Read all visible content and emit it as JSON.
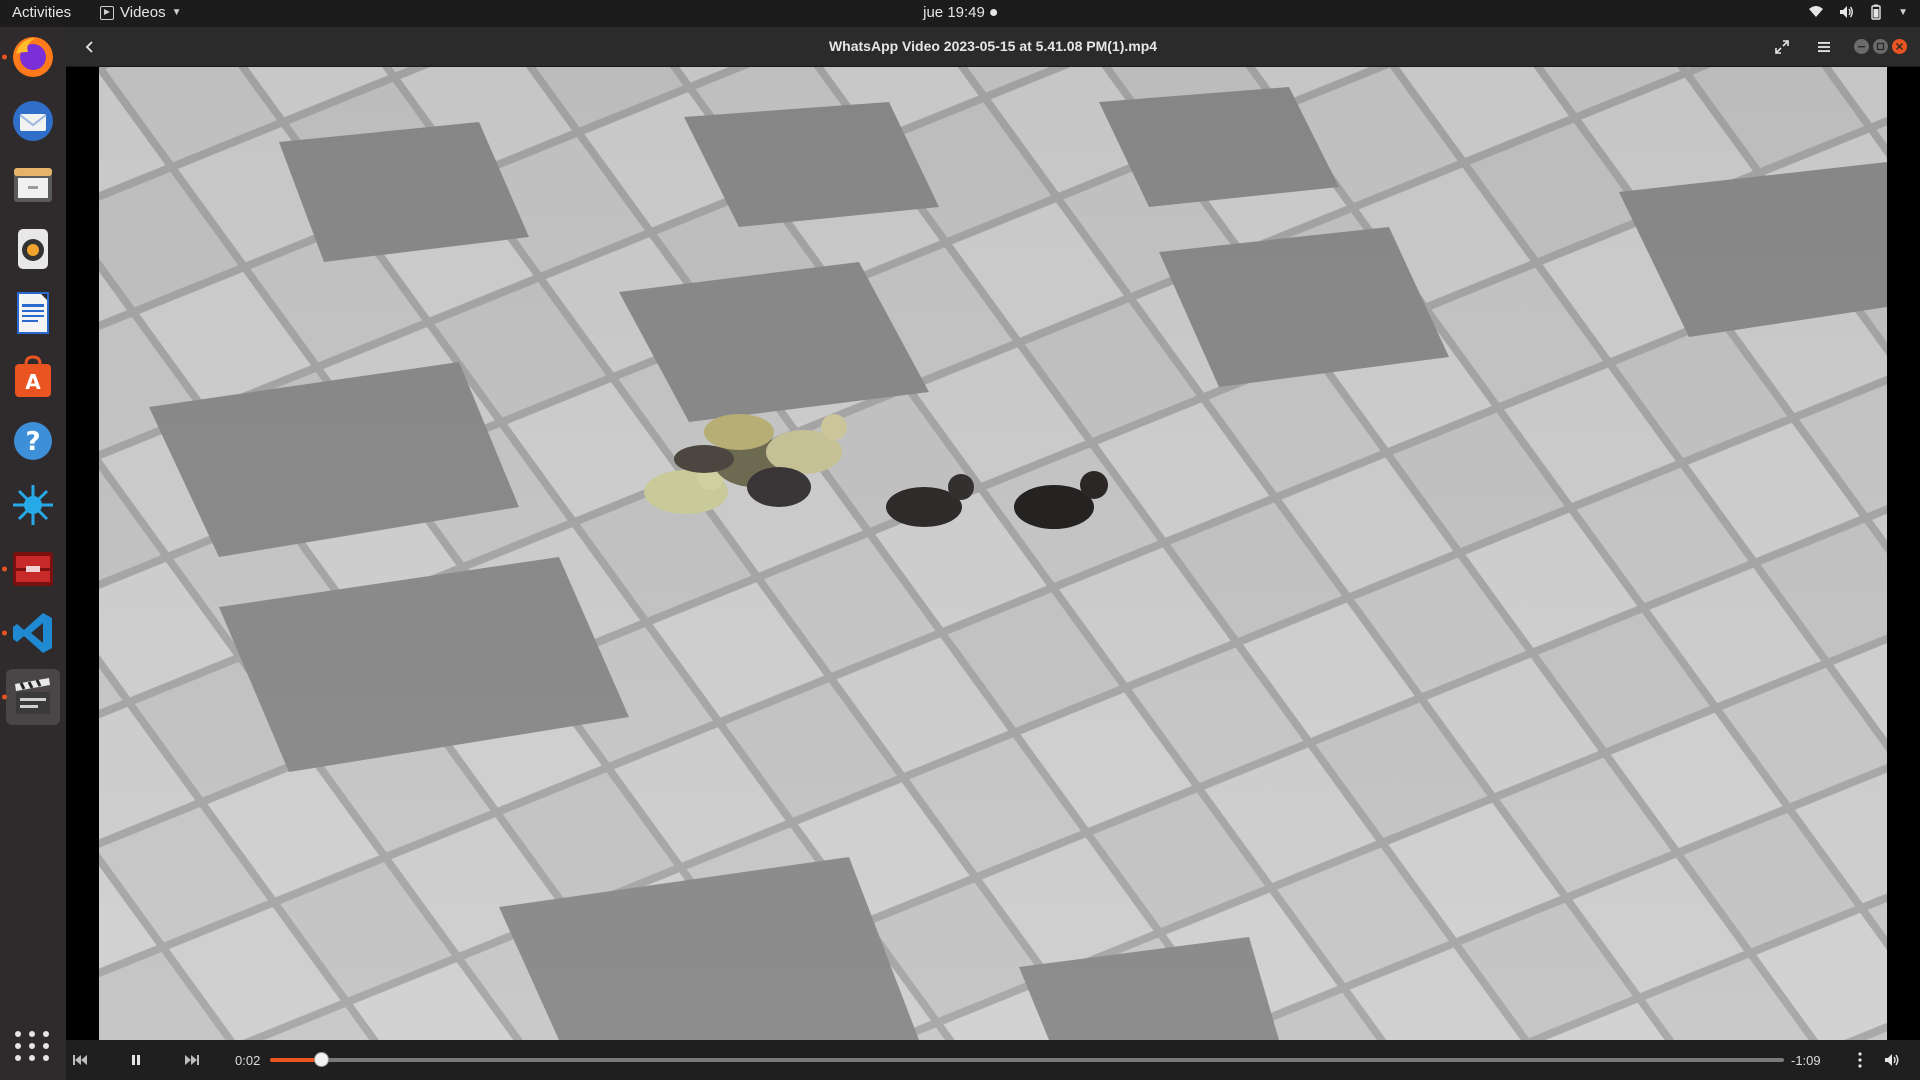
{
  "topbar": {
    "activities_label": "Activities",
    "app_name": "Videos",
    "clock": "jue 19:49"
  },
  "dock": {
    "items": [
      {
        "name": "Firefox",
        "icon": "firefox-icon",
        "running": true
      },
      {
        "name": "Thunderbird",
        "icon": "thunderbird-icon",
        "running": false
      },
      {
        "name": "Files",
        "icon": "files-icon",
        "running": false
      },
      {
        "name": "Rhythmbox",
        "icon": "rhythmbox-icon",
        "running": false
      },
      {
        "name": "LibreOffice Writer",
        "icon": "writer-icon",
        "running": false
      },
      {
        "name": "Ubuntu Software",
        "icon": "software-icon",
        "running": false
      },
      {
        "name": "Help",
        "icon": "help-icon",
        "running": false
      },
      {
        "name": "Splash app",
        "icon": "splash-icon",
        "running": false
      },
      {
        "name": "Red app",
        "icon": "red-app-icon",
        "running": true
      },
      {
        "name": "Visual Studio Code",
        "icon": "vscode-icon",
        "running": true
      },
      {
        "name": "Videos",
        "icon": "videos-icon",
        "running": true,
        "active": true
      }
    ],
    "show_apps_icon": "show-applications-icon"
  },
  "window": {
    "title": "WhatsApp Video 2023-05-15 at 5.41.08 PM(1).mp4"
  },
  "player": {
    "time_elapsed": "0:02",
    "time_remaining": "-1:09",
    "progress_fraction": 0.034,
    "state": "playing"
  },
  "colors": {
    "accent": "#e95420",
    "topbar": "#1c1c1c",
    "dock": "#2f2a2c",
    "headerbar": "#2b2b2b"
  }
}
